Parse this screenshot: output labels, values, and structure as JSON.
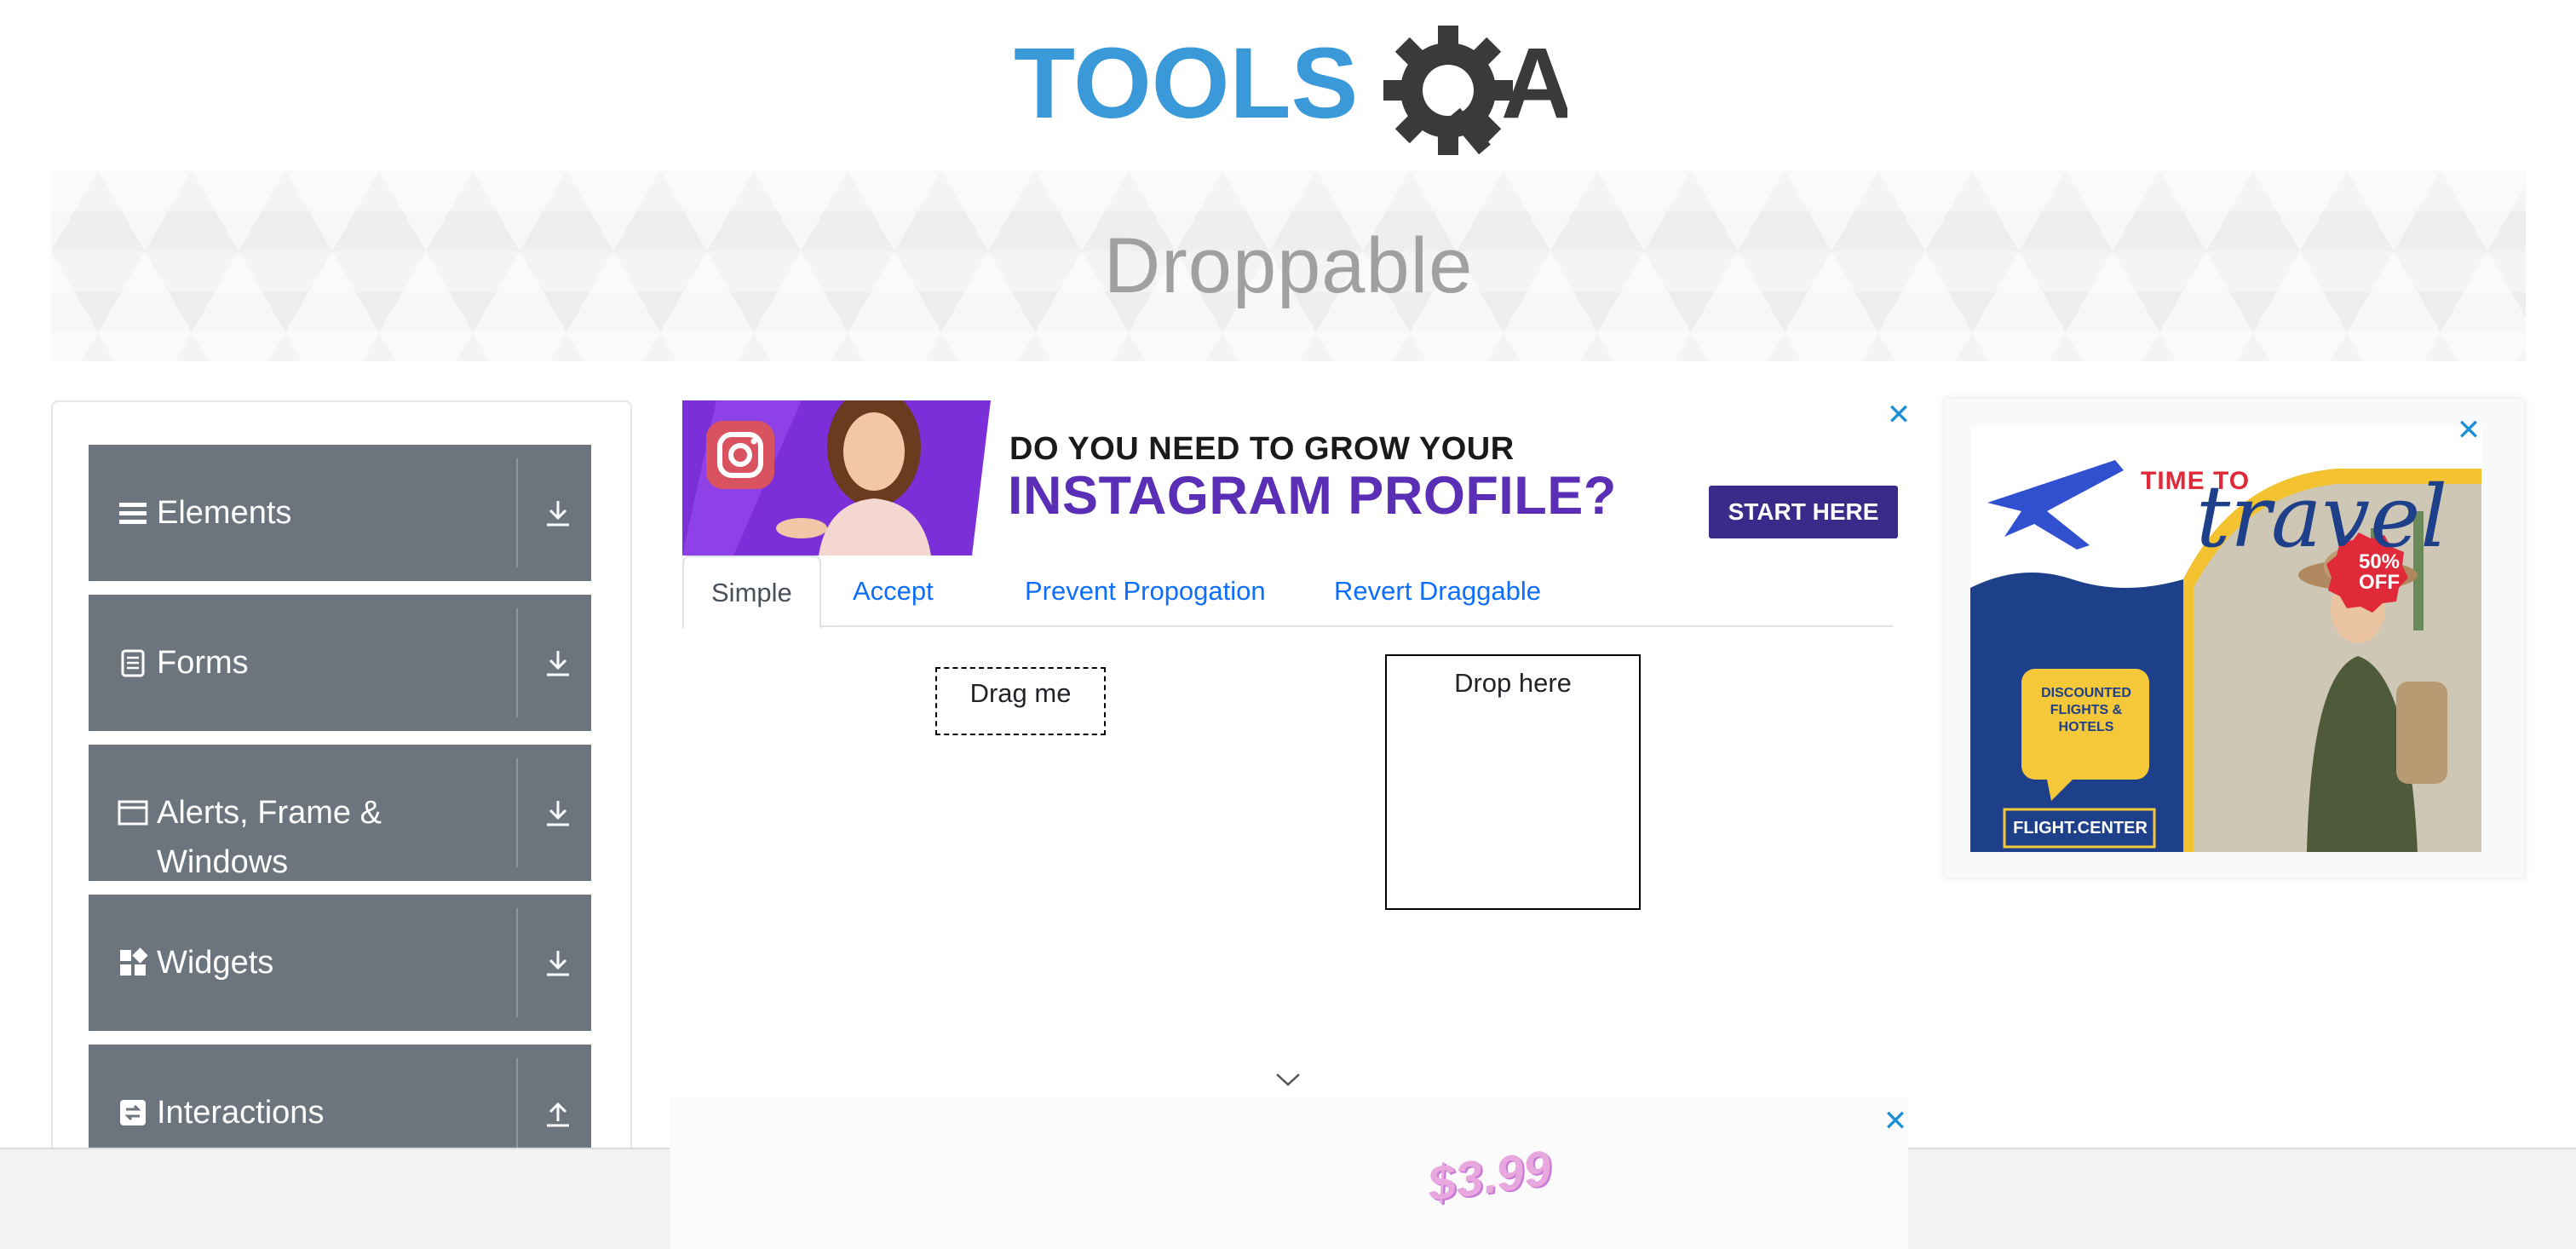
{
  "logo": {
    "text_tools": "TOOLS",
    "text_qa": "QA"
  },
  "banner": {
    "title": "Droppable"
  },
  "sidebar": {
    "groups": [
      {
        "label": "Elements",
        "icon": "list-icon",
        "action": "download-icon"
      },
      {
        "label": "Forms",
        "icon": "document-icon",
        "action": "download-icon"
      },
      {
        "label": "Alerts, Frame & Windows",
        "icon": "window-icon",
        "action": "download-icon"
      },
      {
        "label": "Widgets",
        "icon": "widgets-icon",
        "action": "download-icon"
      },
      {
        "label": "Interactions",
        "icon": "interactions-icon",
        "action": "upload-icon"
      }
    ]
  },
  "top_ad": {
    "line1": "DO YOU NEED TO GROW YOUR",
    "line2": "INSTAGRAM PROFILE?",
    "cta": "START HERE",
    "close": "✕"
  },
  "tabs": [
    {
      "label": "Simple",
      "active": true
    },
    {
      "label": "Accept",
      "active": false
    },
    {
      "label": "Prevent Propogation",
      "active": false
    },
    {
      "label": "Revert Draggable",
      "active": false
    }
  ],
  "drag": {
    "label": "Drag me"
  },
  "drop": {
    "label": "Drop here"
  },
  "side_ad": {
    "headline_small": "TIME TO",
    "headline_script": "travel",
    "badge": "50% OFF",
    "bubble": "DISCOUNTED FLIGHTS & HOTELS",
    "brand": "FLIGHT.CENTER",
    "close": "✕"
  },
  "bottom_ad": {
    "price": "$3.99",
    "close": "✕"
  },
  "colors": {
    "sidebar_group": "#6c757d",
    "tab_link": "#0d6efd",
    "ad_purple": "#5a2fb5",
    "ad_blue": "#1e3f8a",
    "logo_blue": "#3a9ad9",
    "logo_dark": "#3a3a3a"
  }
}
